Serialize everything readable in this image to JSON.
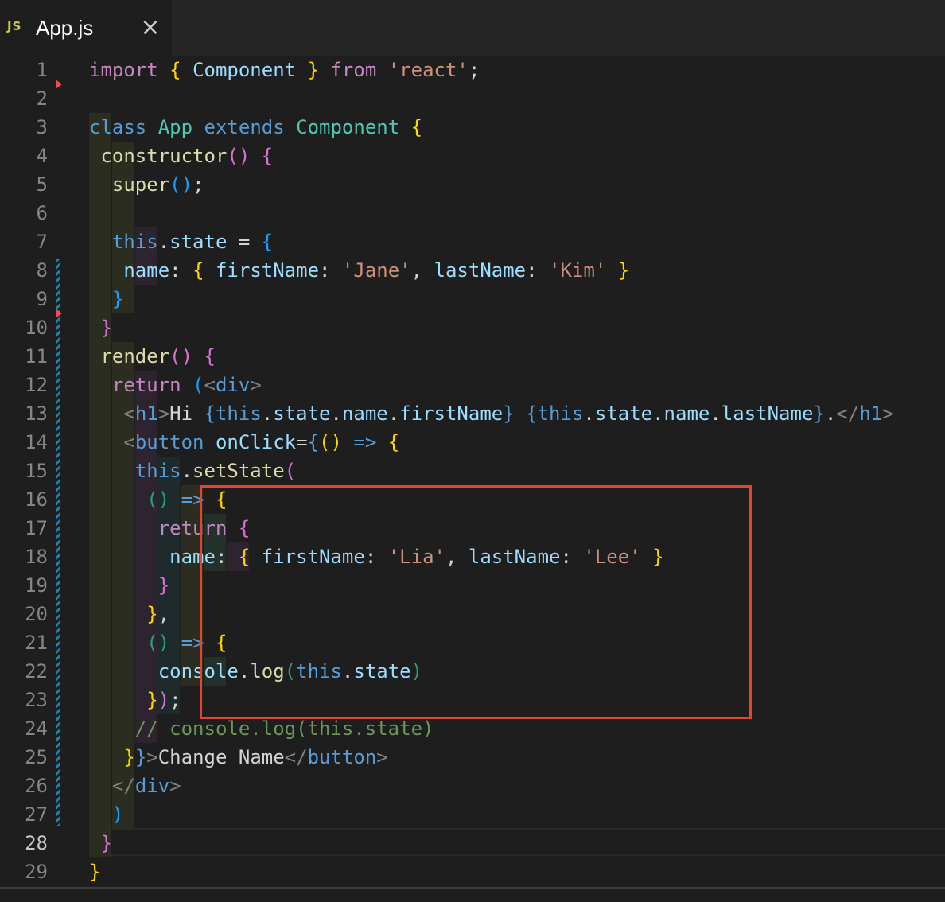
{
  "tab": {
    "badge": "JS",
    "title": "App.js",
    "close_icon": "close-icon"
  },
  "editor": {
    "active_line": 28,
    "line_numbers": [
      "1",
      "2",
      "3",
      "4",
      "5",
      "6",
      "7",
      "8",
      "9",
      "10",
      "11",
      "12",
      "13",
      "14",
      "15",
      "16",
      "17",
      "18",
      "19",
      "20",
      "21",
      "22",
      "23",
      "24",
      "25",
      "26",
      "27",
      "28",
      "29"
    ],
    "lines": [
      [
        [
          "k",
          "import"
        ],
        [
          "p",
          " "
        ],
        [
          "y",
          "{"
        ],
        [
          "p",
          " "
        ],
        [
          "v",
          "Component"
        ],
        [
          "p",
          " "
        ],
        [
          "y",
          "}"
        ],
        [
          "p",
          " "
        ],
        [
          "k",
          "from"
        ],
        [
          "p",
          " "
        ],
        [
          "s",
          "'react'"
        ],
        [
          "p",
          ";"
        ]
      ],
      [],
      [
        [
          "b",
          "class"
        ],
        [
          "p",
          " "
        ],
        [
          "t",
          "App"
        ],
        [
          "p",
          " "
        ],
        [
          "b",
          "extends"
        ],
        [
          "p",
          " "
        ],
        [
          "t",
          "Component"
        ],
        [
          "p",
          " "
        ],
        [
          "y",
          "{"
        ]
      ],
      [
        [
          "p",
          " "
        ],
        [
          "f",
          "constructor"
        ],
        [
          "m",
          "()"
        ],
        [
          "p",
          " "
        ],
        [
          "m",
          "{"
        ]
      ],
      [
        [
          "p",
          "  "
        ],
        [
          "f",
          "super"
        ],
        [
          "bl",
          "()"
        ],
        [
          "p",
          ";"
        ]
      ],
      [],
      [
        [
          "p",
          "  "
        ],
        [
          "b",
          "this"
        ],
        [
          "p",
          "."
        ],
        [
          "v",
          "state"
        ],
        [
          "p",
          " = "
        ],
        [
          "bl",
          "{"
        ]
      ],
      [
        [
          "p",
          "   "
        ],
        [
          "v",
          "name"
        ],
        [
          "p",
          ": "
        ],
        [
          "y",
          "{"
        ],
        [
          "p",
          " "
        ],
        [
          "v",
          "firstName"
        ],
        [
          "p",
          ": "
        ],
        [
          "s",
          "'Jane'"
        ],
        [
          "p",
          ", "
        ],
        [
          "v",
          "lastName"
        ],
        [
          "p",
          ": "
        ],
        [
          "s",
          "'Kim'"
        ],
        [
          "p",
          " "
        ],
        [
          "y",
          "}"
        ]
      ],
      [
        [
          "p",
          "  "
        ],
        [
          "bl",
          "}"
        ]
      ],
      [
        [
          "p",
          " "
        ],
        [
          "m",
          "}"
        ]
      ],
      [
        [
          "p",
          " "
        ],
        [
          "f",
          "render"
        ],
        [
          "m",
          "()"
        ],
        [
          "p",
          " "
        ],
        [
          "m",
          "{"
        ]
      ],
      [
        [
          "p",
          "  "
        ],
        [
          "k",
          "return"
        ],
        [
          "p",
          " "
        ],
        [
          "bl",
          "("
        ],
        [
          "g",
          "<"
        ],
        [
          "b",
          "div"
        ],
        [
          "g",
          ">"
        ]
      ],
      [
        [
          "p",
          "   "
        ],
        [
          "g",
          "<"
        ],
        [
          "b",
          "h1"
        ],
        [
          "g",
          ">"
        ],
        [
          "p",
          "Hi "
        ],
        [
          "b",
          "{"
        ],
        [
          "b",
          "this"
        ],
        [
          "p",
          "."
        ],
        [
          "v",
          "state"
        ],
        [
          "p",
          "."
        ],
        [
          "v",
          "name"
        ],
        [
          "p",
          "."
        ],
        [
          "v",
          "firstName"
        ],
        [
          "b",
          "}"
        ],
        [
          "p",
          " "
        ],
        [
          "b",
          "{"
        ],
        [
          "b",
          "this"
        ],
        [
          "p",
          "."
        ],
        [
          "v",
          "state"
        ],
        [
          "p",
          "."
        ],
        [
          "v",
          "name"
        ],
        [
          "p",
          "."
        ],
        [
          "v",
          "lastName"
        ],
        [
          "b",
          "}"
        ],
        [
          "p",
          "."
        ],
        [
          "g",
          "</"
        ],
        [
          "b",
          "h1"
        ],
        [
          "g",
          ">"
        ]
      ],
      [
        [
          "p",
          "   "
        ],
        [
          "g",
          "<"
        ],
        [
          "b",
          "button"
        ],
        [
          "p",
          " "
        ],
        [
          "v",
          "onClick"
        ],
        [
          "p",
          "="
        ],
        [
          "b",
          "{"
        ],
        [
          "y",
          "()"
        ],
        [
          "p",
          " "
        ],
        [
          "b",
          "=>"
        ],
        [
          "p",
          " "
        ],
        [
          "y",
          "{"
        ]
      ],
      [
        [
          "p",
          "    "
        ],
        [
          "b",
          "this"
        ],
        [
          "p",
          "."
        ],
        [
          "f",
          "setState"
        ],
        [
          "m",
          "("
        ]
      ],
      [
        [
          "p",
          "     "
        ],
        [
          "dgreen",
          "()"
        ],
        [
          "p",
          " "
        ],
        [
          "b",
          "=>"
        ],
        [
          "p",
          " "
        ],
        [
          "y",
          "{"
        ]
      ],
      [
        [
          "p",
          "      "
        ],
        [
          "k",
          "return"
        ],
        [
          "p",
          " "
        ],
        [
          "m",
          "{"
        ]
      ],
      [
        [
          "p",
          "       "
        ],
        [
          "v",
          "name"
        ],
        [
          "p",
          ": "
        ],
        [
          "y",
          "{"
        ],
        [
          "p",
          " "
        ],
        [
          "v",
          "firstName"
        ],
        [
          "p",
          ": "
        ],
        [
          "s",
          "'Lia'"
        ],
        [
          "p",
          ", "
        ],
        [
          "v",
          "lastName"
        ],
        [
          "p",
          ": "
        ],
        [
          "s",
          "'Lee'"
        ],
        [
          "p",
          " "
        ],
        [
          "y",
          "}"
        ]
      ],
      [
        [
          "p",
          "      "
        ],
        [
          "m",
          "}"
        ]
      ],
      [
        [
          "p",
          "     "
        ],
        [
          "y",
          "}"
        ],
        [
          "p",
          ","
        ]
      ],
      [
        [
          "p",
          "     "
        ],
        [
          "dgreen",
          "()"
        ],
        [
          "p",
          " "
        ],
        [
          "b",
          "=>"
        ],
        [
          "p",
          " "
        ],
        [
          "y",
          "{"
        ]
      ],
      [
        [
          "p",
          "      "
        ],
        [
          "v",
          "console"
        ],
        [
          "p",
          "."
        ],
        [
          "f",
          "log"
        ],
        [
          "dgreen",
          "("
        ],
        [
          "b",
          "this"
        ],
        [
          "p",
          "."
        ],
        [
          "v",
          "state"
        ],
        [
          "dgreen",
          ")"
        ]
      ],
      [
        [
          "p",
          "     "
        ],
        [
          "y",
          "}"
        ],
        [
          "m",
          ")"
        ],
        [
          "p",
          ";"
        ]
      ],
      [
        [
          "p",
          "    "
        ],
        [
          "c",
          "// console.log(this.state)"
        ]
      ],
      [
        [
          "p",
          "   "
        ],
        [
          "y",
          "}"
        ],
        [
          "b",
          "}"
        ],
        [
          "g",
          ">"
        ],
        [
          "p",
          "Change Name"
        ],
        [
          "g",
          "</"
        ],
        [
          "b",
          "button"
        ],
        [
          "g",
          ">"
        ]
      ],
      [
        [
          "p",
          "  "
        ],
        [
          "g",
          "</"
        ],
        [
          "b",
          "div"
        ],
        [
          "g",
          ">"
        ]
      ],
      [
        [
          "p",
          "  "
        ],
        [
          "bl",
          ")"
        ]
      ],
      [
        [
          "p",
          " "
        ],
        [
          "m",
          "}"
        ]
      ],
      [
        [
          "y",
          "}"
        ]
      ]
    ]
  },
  "gutter": {
    "modified_icon": "diff-modified-marker",
    "deleted_icon": "diff-deleted-marker"
  },
  "colors": {
    "highlight_box": "#e8432e",
    "background": "#1e1e1e"
  }
}
